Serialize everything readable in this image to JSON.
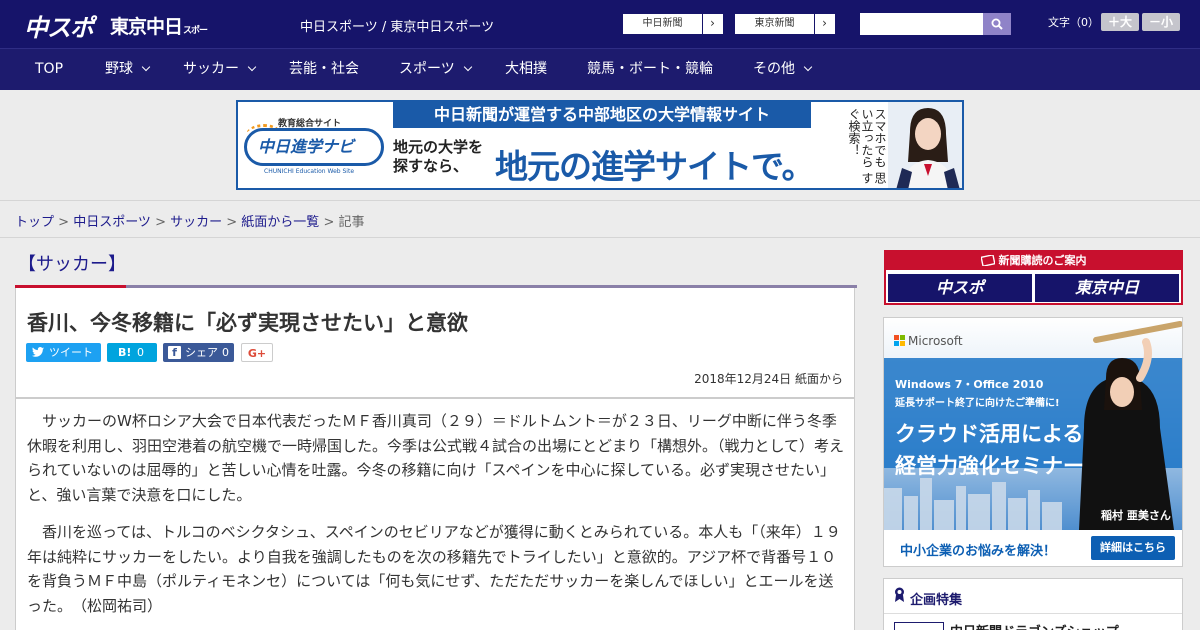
{
  "header": {
    "logo_main": "中スポ",
    "logo_sub": "東京中日",
    "logo_sub_small": "スポーツ",
    "site_names": "中日スポーツ / 東京中日スポーツ",
    "paper_links": [
      {
        "label": "中日新聞"
      },
      {
        "label": "東京新聞"
      }
    ],
    "search_placeholder": "",
    "font_size_label": "文字（0）",
    "font_plus": "＋大",
    "font_minus": "－小"
  },
  "nav": {
    "items": [
      {
        "label": "TOP"
      },
      {
        "label": "野球"
      },
      {
        "label": "サッカー"
      },
      {
        "label": "芸能・社会"
      },
      {
        "label": "スポーツ"
      },
      {
        "label": "大相撲"
      },
      {
        "label": "競馬・ボート・競輪"
      },
      {
        "label": "その他"
      }
    ]
  },
  "banner": {
    "tag": "教育総合サイト",
    "logo": "中日進学ナビ",
    "logo_en": "CHUNICHI Education Web Site",
    "headline": "中日新聞が運営する中部地区の大学情報サイト",
    "small1": "地元の大学を",
    "small2": "探すなら、",
    "big": "地元の進学サイトで。",
    "vertical": "スマホでも 思い立ったら すぐ検索！"
  },
  "breadcrumb": {
    "items": [
      {
        "label": "トップ"
      },
      {
        "label": "中日スポーツ"
      },
      {
        "label": "サッカー"
      },
      {
        "label": "紙面から一覧"
      }
    ],
    "current": "記事",
    "sep": " > "
  },
  "article": {
    "category": "【サッカー】",
    "headline": "香川、今冬移籍に「必ず実現させたい」と意欲",
    "share": {
      "tweet": "ツイート",
      "hatena_icon": "B!",
      "hatena_count": "0",
      "facebook_icon": "f",
      "facebook_label": "シェア",
      "facebook_count": "0",
      "gplus": "G+"
    },
    "dateline": "2018年12月24日 紙面から",
    "paragraphs": [
      "サッカーのW杯ロシア大会で日本代表だったＭＦ香川真司（２９）＝ドルトムント＝が２３日、リーグ中断に伴う冬季休暇を利用し、羽田空港着の航空機で一時帰国した。今季は公式戦４試合の出場にとどまり「構想外。（戦力として）考えられていないのは屈辱的」と苦しい心情を吐露。今冬の移籍に向け「スペインを中心に探している。必ず実現させたい」と、強い言葉で決意を口にした。",
      "香川を巡っては、トルコのベシクタシュ、スペインのセビリアなどが獲得に動くとみられている。本人も「（来年）１９年は純粋にサッカーをしたい。より自我を強調したものを次の移籍先でトライしたい」と意欲的。アジア杯で背番号１０を背負うＭＦ中島（ポルティモネンセ）については「何も気にせず、ただただサッカーを楽しんでほしい」とエールを送った。　（松岡祐司）"
    ]
  },
  "sidebar": {
    "subscribe_title": "新聞購読のご案内",
    "subscribe_logos": [
      "中スポ",
      "東京中日"
    ],
    "ms_ad": {
      "brand": "Microsoft",
      "line1": "Windows 7・Office 2010",
      "line2": "延長サポート終了に向けたご準備に!",
      "big1": "クラウド活用による",
      "big2": "経営力強化セミナー",
      "person": "稲村 亜美さん",
      "cta": "中小企業のお悩みを解決！",
      "button": "詳細はこちら"
    },
    "feature_title": "企画特集",
    "feature_item": "中日新聞ドラゴンズショップ"
  },
  "colors": {
    "header_bg": "#16146a",
    "nav_bg": "#1d1b6e",
    "accent_red": "#c8102e",
    "link": "#1d1b8c",
    "twitter": "#1da1f2",
    "hatena": "#00a4de",
    "facebook": "#3b5998"
  }
}
